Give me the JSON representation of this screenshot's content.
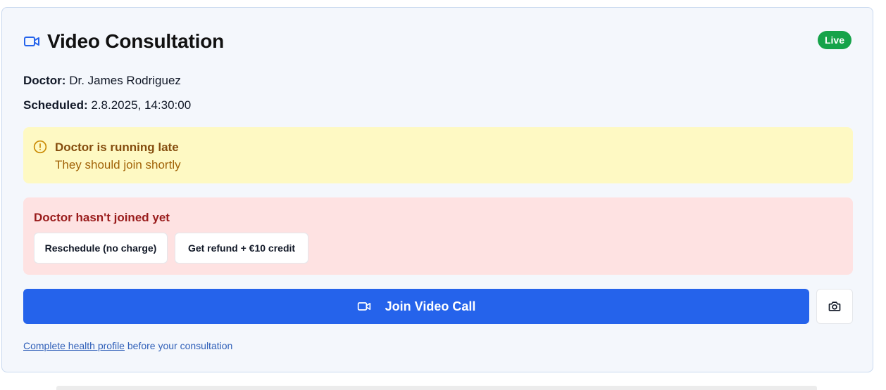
{
  "header": {
    "title": "Video Consultation",
    "title_icon": "video-camera-icon",
    "live_badge": "Live"
  },
  "details": {
    "doctor_label": "Doctor:",
    "doctor_value": "Dr. James Rodriguez",
    "scheduled_label": "Scheduled:",
    "scheduled_value": "2.8.2025, 14:30:00"
  },
  "late_notice": {
    "icon": "alert-circle-icon",
    "title": "Doctor is running late",
    "subtitle": "They should join shortly"
  },
  "not_joined": {
    "title": "Doctor hasn't joined yet",
    "reschedule_label": "Reschedule (no charge)",
    "refund_label": "Get refund + €10 credit"
  },
  "actions": {
    "join_label": "Join Video Call",
    "join_icon": "video-camera-icon",
    "snapshot_icon": "camera-icon"
  },
  "footer": {
    "link_text": "Complete health profile",
    "rest_text": " before your consultation"
  },
  "colors": {
    "primary": "#2563eb",
    "live": "#16a34a",
    "warning_bg": "#fef9c3",
    "warning_text": "#854d0e",
    "alert_bg": "#fee2e2",
    "alert_text": "#991b1b",
    "link": "#2f5fb8"
  }
}
